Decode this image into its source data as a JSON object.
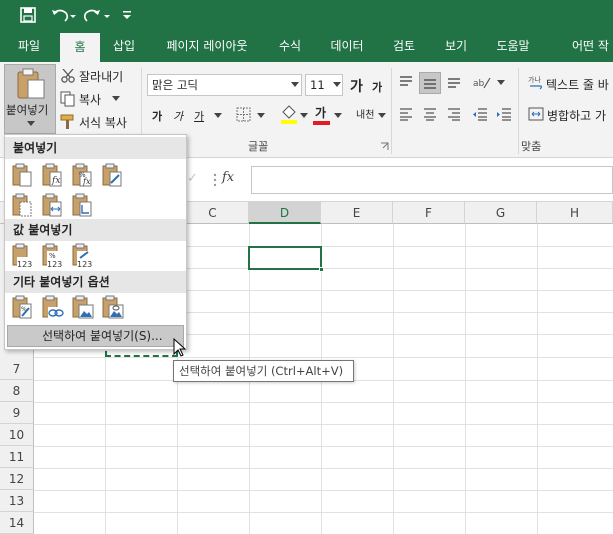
{
  "colors": {
    "brand": "#217346",
    "selection": "#217346"
  },
  "qat": {
    "save_icon": "save-icon",
    "undo_icon": "undo-icon",
    "redo_icon": "redo-icon",
    "customize_icon": "customize-qat-icon"
  },
  "tabs": [
    "파일",
    "홈",
    "삽입",
    "페이지 레이아웃",
    "수식",
    "데이터",
    "검토",
    "보기",
    "도움말",
    "어떤 작"
  ],
  "active_tab": "홈",
  "ribbon": {
    "clipboard": {
      "paste_label": "붙여넣기",
      "cut_label": "잘라내기",
      "copy_label": "복사",
      "format_painter_label": "서식 복사"
    },
    "font": {
      "font_name": "맑은 고딕",
      "font_size": "11",
      "grow_label": "가",
      "shrink_label": "가",
      "bold_label": "가",
      "italic_label": "가",
      "underline_label": "가",
      "font_color_label": "가",
      "phonetic_label": "내천",
      "group_label": "글꼴"
    },
    "alignment": {
      "wrap_text_label": "텍스트 줄 바",
      "merge_label": "병합하고 가",
      "group_label": "맞춤"
    }
  },
  "formula_bar": {
    "fx_label": "fx",
    "cancel_icon": "✕",
    "enter_icon": "✓"
  },
  "columns": [
    "C",
    "D",
    "E",
    "F",
    "G",
    "H"
  ],
  "selected_column": "D",
  "rows": [
    "7",
    "8",
    "9",
    "10",
    "11",
    "12",
    "13",
    "14"
  ],
  "paste_menu": {
    "section1": "붙여넣기",
    "section2": "값 붙여넣기",
    "section3": "기타 붙여넣기 옵션",
    "paste_special": "선택하여 붙여넣기(S)..."
  },
  "tooltip": "선택하여 붙여넣기 (Ctrl+Alt+V)"
}
